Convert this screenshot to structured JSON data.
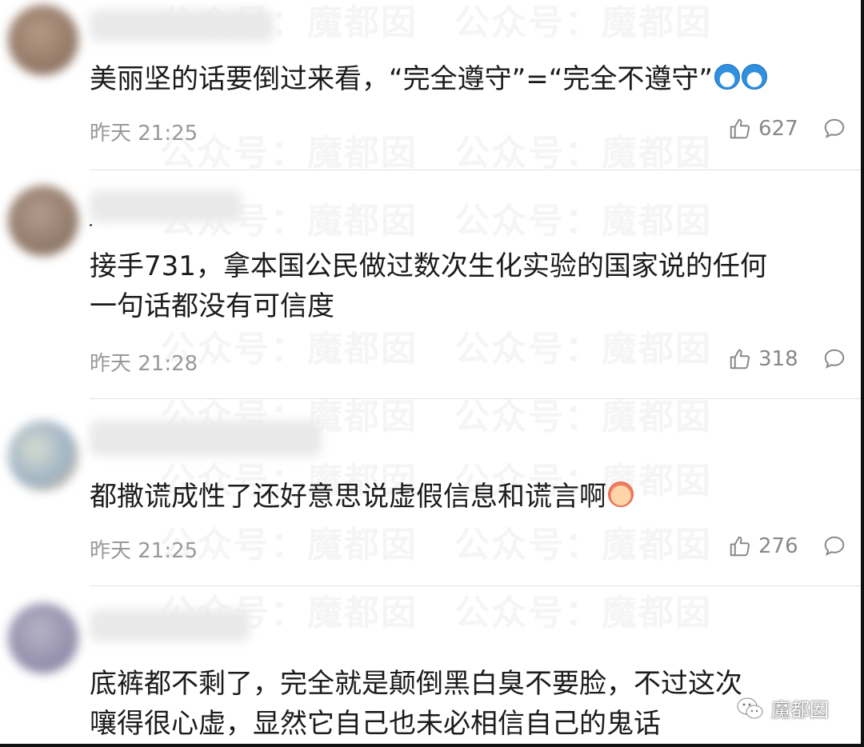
{
  "watermark_text": "公众号：魔都囡",
  "brand": {
    "label": "魔都囡",
    "icon": "wechat-icon"
  },
  "comments": [
    {
      "text": "美丽坚的话要倒过来看，“完全遵守”=“完全不遵守”",
      "emoji": "doraemon-emoji x2",
      "time": "昨天 21:25",
      "likes": "627"
    },
    {
      "text": "接手731，拿本国公民做过数次生化实验的国家说的任何\n一句话都没有可信度",
      "time": "昨天 21:28",
      "likes": "318"
    },
    {
      "text": "都撒谎成性了还好意思说虚假信息和谎言啊",
      "emoji": "grin-emoji",
      "time": "昨天 21:25",
      "likes": "276"
    },
    {
      "text": "底裤都不剩了，完全就是颠倒黑白臭不要脸，不过这次\n嚷得很心虚，显然它自己也未必相信自己的鬼话"
    }
  ],
  "colors": {
    "text": "#1b1b1b",
    "meta": "#999999",
    "divider": "#e3e3e3"
  }
}
